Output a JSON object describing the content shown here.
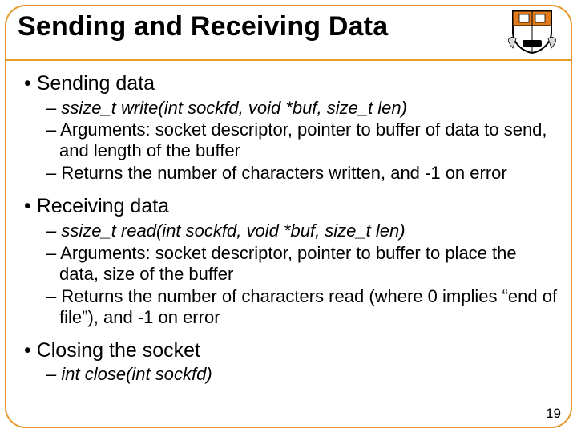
{
  "title": "Sending and Receiving Data",
  "page_number": "19",
  "sections": [
    {
      "heading": "Sending data",
      "items": [
        {
          "text": "ssize_t write(int sockfd, void *buf, size_t len)",
          "italic": true
        },
        {
          "text": "Arguments: socket descriptor, pointer to buffer of data to send, and length of the buffer",
          "italic": false
        },
        {
          "text": "Returns the number of characters written, and -1 on error",
          "italic": false
        }
      ]
    },
    {
      "heading": "Receiving data",
      "items": [
        {
          "text": "ssize_t read(int sockfd, void *buf, size_t len)",
          "italic": true
        },
        {
          "text": "Arguments: socket descriptor, pointer to buffer to place the data, size of the buffer",
          "italic": false
        },
        {
          "text": "Returns the number of characters read (where 0 implies “end of file”), and -1 on error",
          "italic": false
        }
      ]
    },
    {
      "heading": "Closing the socket",
      "items": [
        {
          "text": "int close(int sockfd)",
          "italic": true
        }
      ]
    }
  ]
}
